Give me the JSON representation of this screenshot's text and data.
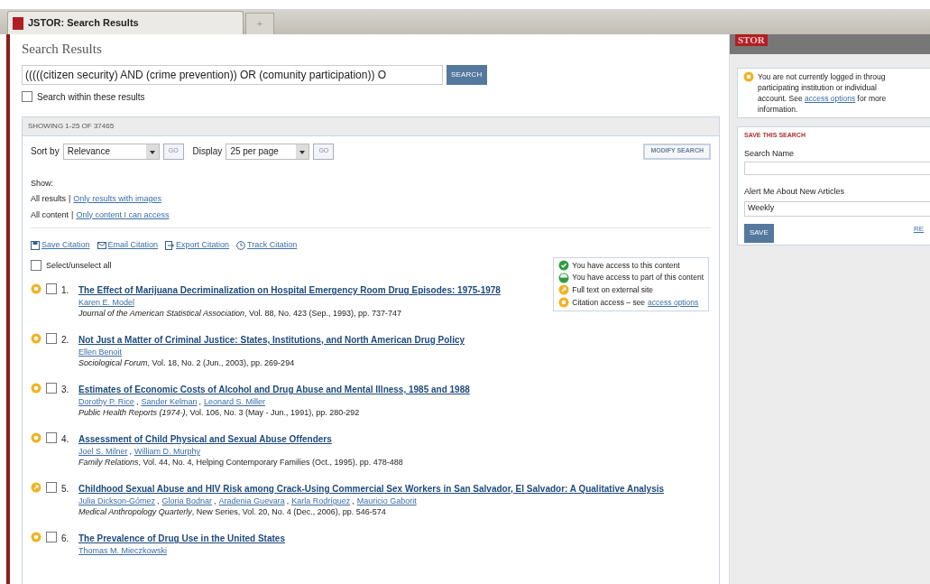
{
  "browser_tab": {
    "title": "JSTOR: Search Results",
    "new_tab": "+"
  },
  "page_title": "Search Results",
  "search": {
    "value": "(((((citizen security) AND (crime prevention)) OR (comunity participation)) O",
    "button": "SEARCH",
    "within": {
      "label": "Search within these results",
      "checked": false
    }
  },
  "results_header": "SHOWING 1-25 OF 37465",
  "sort": {
    "label": "Sort by",
    "value": "Relevance",
    "go": "GO"
  },
  "display": {
    "label": "Display",
    "value": "25 per page",
    "go": "GO"
  },
  "modify_button": "MODIFY SEARCH",
  "show": {
    "label": "Show:",
    "lines": [
      {
        "current": "All results",
        "separator": "|",
        "link": "Only results with images"
      },
      {
        "current": "All content",
        "separator": "|",
        "link": "Only content I can access"
      }
    ]
  },
  "author_separator": ",",
  "actions": [
    {
      "kind": "save",
      "label": "Save Citation"
    },
    {
      "kind": "email",
      "label": "Email Citation"
    },
    {
      "kind": "export",
      "label": "Export Citation"
    },
    {
      "kind": "track",
      "label": "Track Citation"
    }
  ],
  "select_all": {
    "label": "Select/unselect all",
    "checked": false
  },
  "legend": [
    {
      "kind": "full",
      "text": "You have access to this content"
    },
    {
      "kind": "partial",
      "text": "You have access to part of this content"
    },
    {
      "kind": "external",
      "text": "Full text on external site"
    },
    {
      "kind": "citation",
      "text": "Citation access – see",
      "link": "access options"
    }
  ],
  "results": [
    {
      "kind": "citation",
      "checked": false,
      "number": "1.",
      "title": "The Effect of Marijuana Decriminalization on Hospital Emergency Room Drug Episodes: 1975-1978",
      "authors": [
        "Karen E. Model"
      ],
      "source": "*Journal of the American Statistical Association*, Vol. 88, No. 423 (Sep., 1993), pp. 737-747"
    },
    {
      "kind": "citation",
      "checked": false,
      "number": "2.",
      "title": "Not Just a Matter of Criminal Justice: States, Institutions, and North American Drug Policy",
      "authors": [
        "Ellen Benoit"
      ],
      "source": "*Sociological Forum*, Vol. 18, No. 2 (Jun., 2003), pp. 269-294"
    },
    {
      "kind": "citation",
      "checked": false,
      "number": "3.",
      "title": "Estimates of Economic Costs of Alcohol and Drug Abuse and Mental Illness, 1985 and 1988",
      "authors": [
        "Dorothy P. Rice",
        "Sander Kelman",
        "Leonard S. Miller"
      ],
      "source": "*Public Health Reports (1974-)*, Vol. 106, No. 3 (May - Jun., 1991), pp. 280-292"
    },
    {
      "kind": "citation",
      "checked": false,
      "number": "4.",
      "title": "Assessment of Child Physical and Sexual Abuse Offenders",
      "authors": [
        "Joel S. Milner",
        "William D. Murphy"
      ],
      "source": "*Family Relations*, Vol. 44, No. 4, Helping Contemporary Families (Oct., 1995), pp. 478-488"
    },
    {
      "kind": "external",
      "checked": false,
      "number": "5.",
      "title": "Childhood Sexual Abuse and HIV Risk among Crack-Using Commercial Sex Workers in San Salvador, El Salvador: A Qualitative Analysis",
      "authors": [
        "Julia Dickson-Gómez",
        "Gloria Bodnar",
        "Aradenia Guevara",
        "Karla Rodríguez",
        "Mauricio Gaborit"
      ],
      "source": "*Medical Anthropology Quarterly*, New Series, Vol. 20, No. 4 (Dec., 2006), pp. 546-574"
    },
    {
      "kind": "citation",
      "checked": false,
      "number": "6.",
      "title": "The Prevalence of Drug Use in the United States",
      "authors": [
        "Thomas M. Mieczkowski"
      ]
    }
  ],
  "sidebar": {
    "logo": "STOR",
    "notice": {
      "text": "You are not currently logged in throug participating institution or individual account. See",
      "link": "access options",
      "after": "for more information."
    },
    "save_search": {
      "heading": "SAVE THIS SEARCH",
      "name_label": "Search Name",
      "alert_label": "Alert Me About New Articles",
      "alert_value": "Weekly",
      "button": "SAVE",
      "link": "RE"
    }
  }
}
